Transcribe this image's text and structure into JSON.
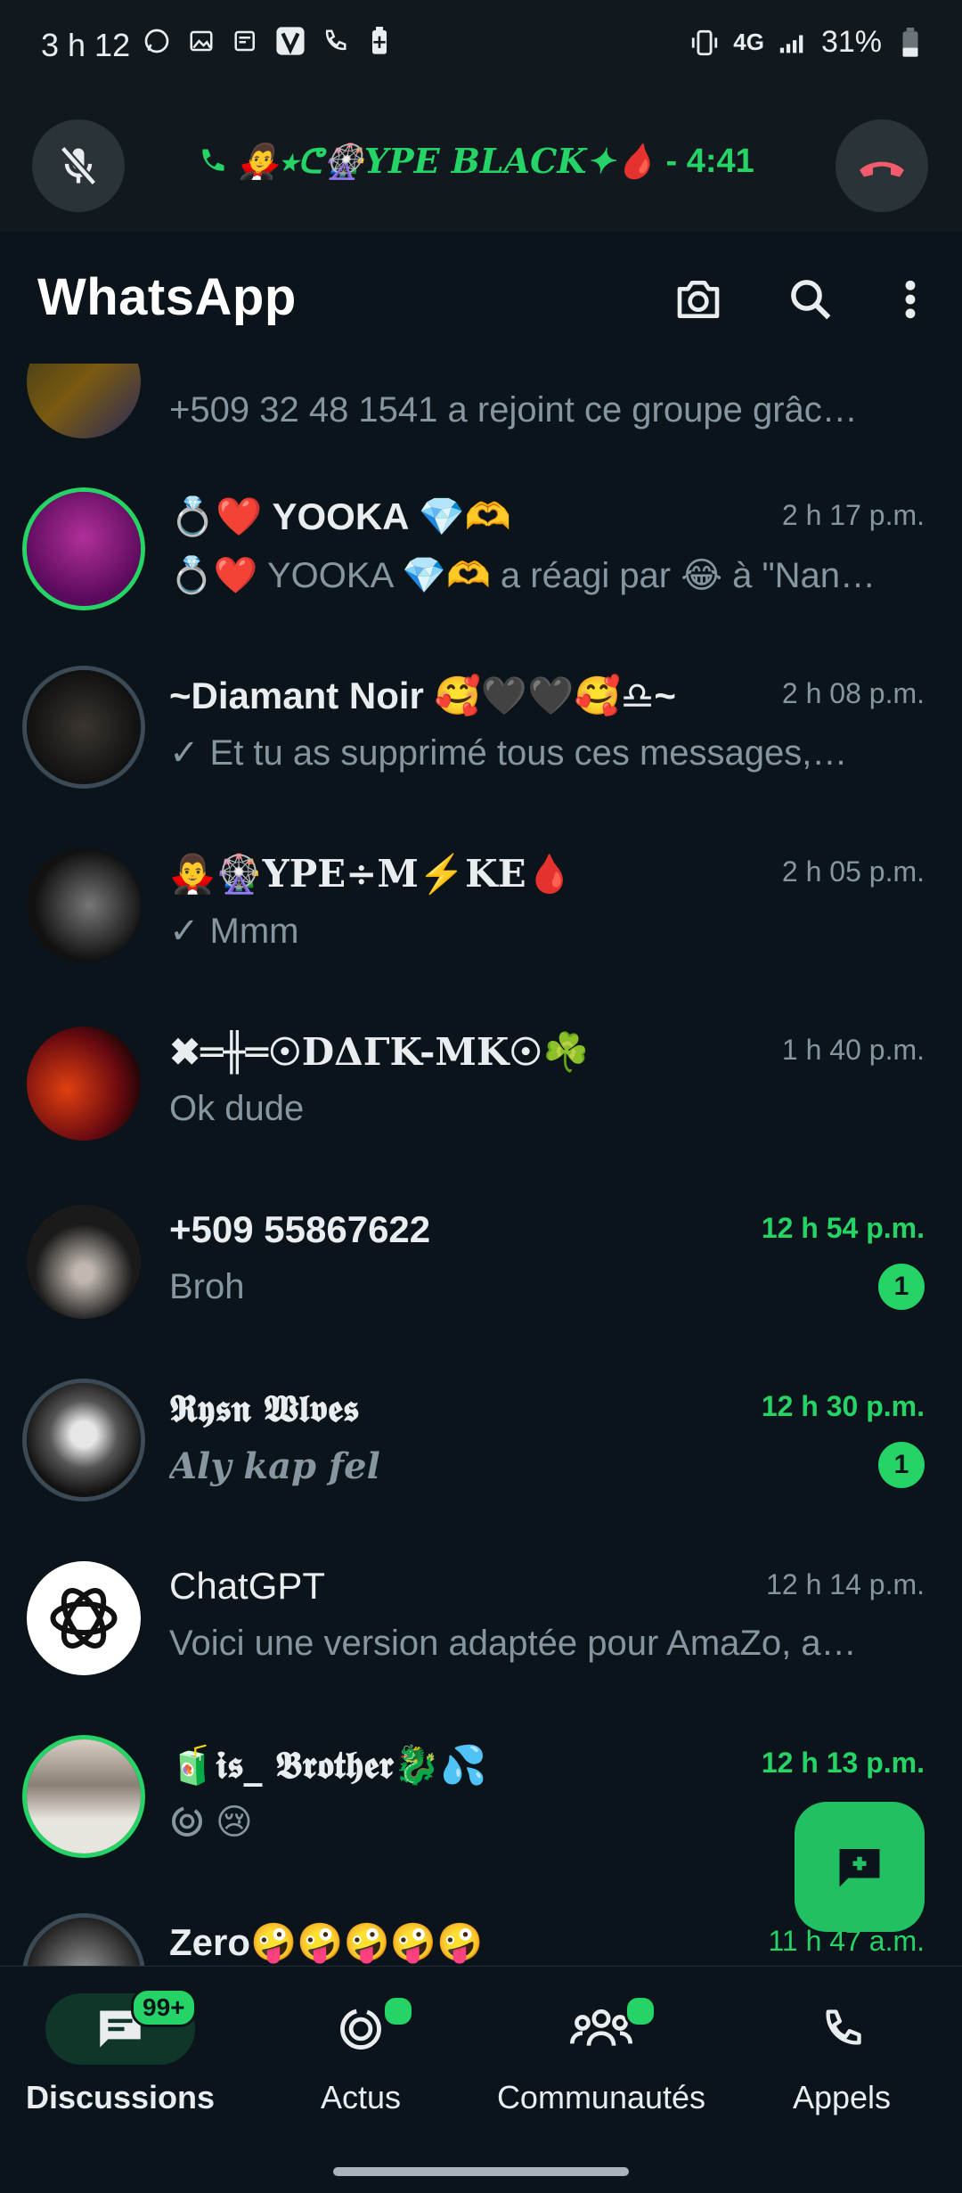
{
  "status_bar": {
    "time": "3 h 12",
    "network": "4G",
    "battery": "31%"
  },
  "call_bar": {
    "caller": "🧛‍♂️⭑ᕦ🎡YPE BLACK✦🩸",
    "duration": "- 4:41"
  },
  "app_bar": {
    "title": "WhatsApp"
  },
  "chats": [
    {
      "name": "",
      "time": "",
      "message": "+509 32 48 1541 a rejoint ce groupe grâc…",
      "unread": ""
    },
    {
      "name": "💍❤️ YOOKA 💎🫶",
      "time": "2 h 17 p.m.",
      "message": "💍❤️ YOOKA 💎🫶 a réagi par 😂 à \"Nan…",
      "unread": ""
    },
    {
      "name": "~Diamant Noir 🥰🖤🖤🥰♎~",
      "time": "2 h 08 p.m.",
      "message": "Et tu as supprimé tous ces messages,…",
      "unread": ""
    },
    {
      "name": "🧛‍♂️🎡YPE÷M⚡KE🩸",
      "time": "2 h 05 p.m.",
      "message": "Mmm",
      "unread": ""
    },
    {
      "name": "✖═╫═☉DΔΓK-MK☉☘️",
      "time": "1 h 40 p.m.",
      "message": "Ok dude",
      "unread": ""
    },
    {
      "name": "+509 55867622",
      "time": "12 h 54 p.m.",
      "message": "Broh",
      "unread": "1"
    },
    {
      "name": "𝕽𝖞𝖘𝖓 𝖂𝖑𝖛𝖊𝖘",
      "time": "12 h 30 p.m.",
      "message": "Aly kap fel",
      "unread": "1"
    },
    {
      "name": "ChatGPT",
      "time": "12 h 14 p.m.",
      "message": "Voici une version adaptée pour AmaZo, a…",
      "unread": ""
    },
    {
      "name": "🧃𝖎𝖘_ 𝕭𝖗𝖔𝖙𝖍𝖊𝖗🐉💦",
      "time": "12 h 13 p.m.",
      "message": "😢",
      "unread": ""
    },
    {
      "name": "Zero🤪🤪🤪🤪🤪",
      "time": "11 h 47 a.m.",
      "message": "",
      "unread": ""
    }
  ],
  "bottom_nav": {
    "discussions": "Discussions",
    "discussions_badge": "99+",
    "actus": "Actus",
    "communautes": "Communautés",
    "appels": "Appels"
  },
  "colors": {
    "accent": "#25d366",
    "background": "#0b141a",
    "secondary_text": "#8696a0"
  }
}
